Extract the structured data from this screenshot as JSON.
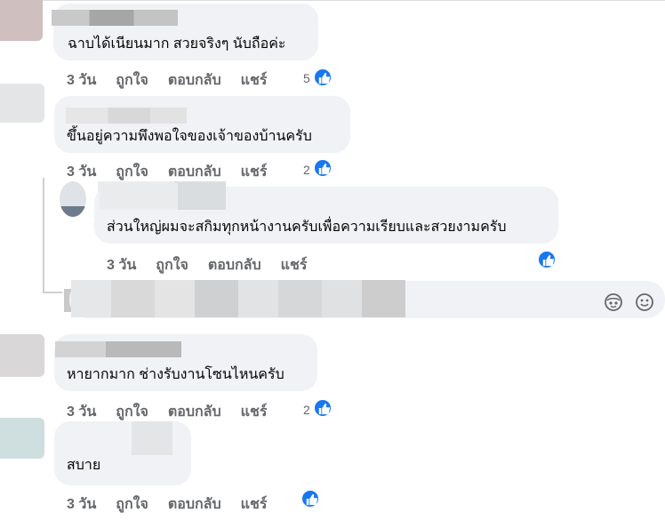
{
  "actions": {
    "time": "3 วัน",
    "like": "ถูกใจ",
    "reply": "ตอบกลับ",
    "share": "แชร์"
  },
  "colors": {
    "accent": "#1877f2",
    "bubble": "#f0f2f5",
    "muted": "#65676b"
  },
  "comments": [
    {
      "text": "ฉาบได้เนียนมาก สวยจริงๆ นับถือค่ะ",
      "reactions": "5"
    },
    {
      "text": "ขึ้นอยู่ความพึงพอใจของเจ้าของบ้านครับ",
      "reactions": "2"
    },
    {
      "text": "ส่วนใหญ่ผมจะสกิมทุกหน้างานครับเพื่อความเรียบและสวยงามครับ",
      "reactions": ""
    },
    {
      "text": "หายากมาก ช่างรับงานโซนไหนครับ",
      "reactions": "2"
    },
    {
      "text": "สบาย",
      "reactions": ""
    }
  ],
  "reply_input": {
    "placeholder": ""
  },
  "icons": {
    "like": "like-icon",
    "avatar_sticker": "avatar-sticker-icon",
    "emoji": "emoji-icon"
  }
}
